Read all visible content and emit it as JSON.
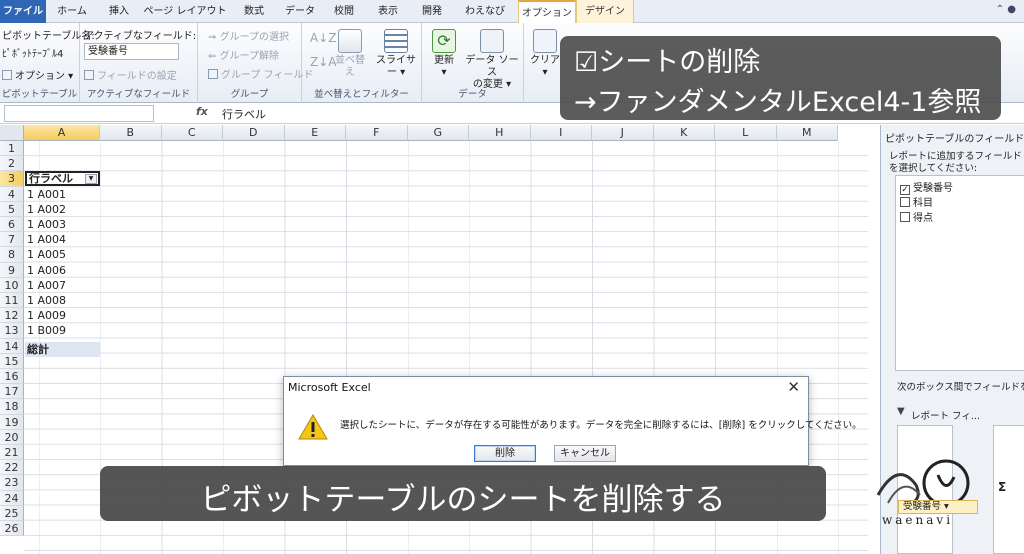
{
  "tabs": [
    "ファイル",
    "ホーム",
    "挿入",
    "ページ レイアウト",
    "数式",
    "データ",
    "校閲",
    "表示",
    "開発",
    "わえなび",
    "オプション",
    "デザイン"
  ],
  "ribbon": {
    "pivot_name_label": "ピボットテーブル名:",
    "pivot_name_value": "ﾋﾟﾎﾞｯﾄﾃｰﾌﾞﾙ4",
    "options_button": "オプション",
    "group_pivot": "ピボットテーブル",
    "active_field_label": "アクティブなフィールド:",
    "active_field_value": "受験番号",
    "field_settings": "フィールドの設定",
    "group_active_field": "アクティブなフィールド",
    "group_selection": "グループの選択",
    "ungroup": "グループ解除",
    "group_field": "グループ フィールド",
    "group_group": "グループ",
    "sort_button": "並べ替え",
    "slicer_button": "スライサー",
    "group_sort_filter": "並べ替えとフィルター",
    "refresh_button": "更新",
    "change_source_line1": "データ ソース",
    "change_source_line2": "の変更",
    "group_data": "データ",
    "clear_button": "クリア"
  },
  "formula_bar": {
    "fx": "fx",
    "value": "行ラベル"
  },
  "columns": [
    "A",
    "B",
    "C",
    "D",
    "E",
    "F",
    "G",
    "H",
    "I",
    "J",
    "K",
    "L",
    "M"
  ],
  "rows": [
    "1",
    "2",
    "3",
    "4",
    "5",
    "6",
    "7",
    "8",
    "9",
    "10",
    "11",
    "12",
    "13",
    "14",
    "15",
    "16",
    "17",
    "18",
    "19",
    "20",
    "21",
    "22",
    "23",
    "24",
    "25",
    "26"
  ],
  "pivot": {
    "header": "行ラベル",
    "items": [
      "1 A001",
      "1 A002",
      "1 A003",
      "1 A004",
      "1 A005",
      "1 A006",
      "1 A007",
      "1 A008",
      "1 A009",
      "1 B009"
    ],
    "total": "総計"
  },
  "field_list": {
    "title": "ピボットテーブルのフィールド リスト",
    "hint": "レポートに追加するフィールドを選択してください:",
    "fields": [
      {
        "label": "受験番号",
        "checked": true
      },
      {
        "label": "科目",
        "checked": false
      },
      {
        "label": "得点",
        "checked": false
      }
    ],
    "drag_hint": "次のボックス間でフィールドをドラッグしてください:",
    "report_filter": "レポート フィ...",
    "row_chip": "受験番号 ▾",
    "sigma": "Σ"
  },
  "dialog": {
    "title": "Microsoft Excel",
    "close": "✕",
    "message": "選択したシートに、データが存在する可能性があります。データを完全に削除するには、[削除] をクリックしてください。",
    "delete_button": "削除",
    "cancel_button": "キャンセル"
  },
  "overlay_top": {
    "line1": "☑シートの削除",
    "line2": "→ファンダメンタルExcel4-1参照"
  },
  "overlay_bottom": {
    "text": "ピボットテーブルのシートを削除する"
  },
  "watermark": "waenavi",
  "colors": {
    "file_tab": "#2f66b6",
    "selection_header": "#f5cc5e",
    "overlay": "#464646"
  }
}
